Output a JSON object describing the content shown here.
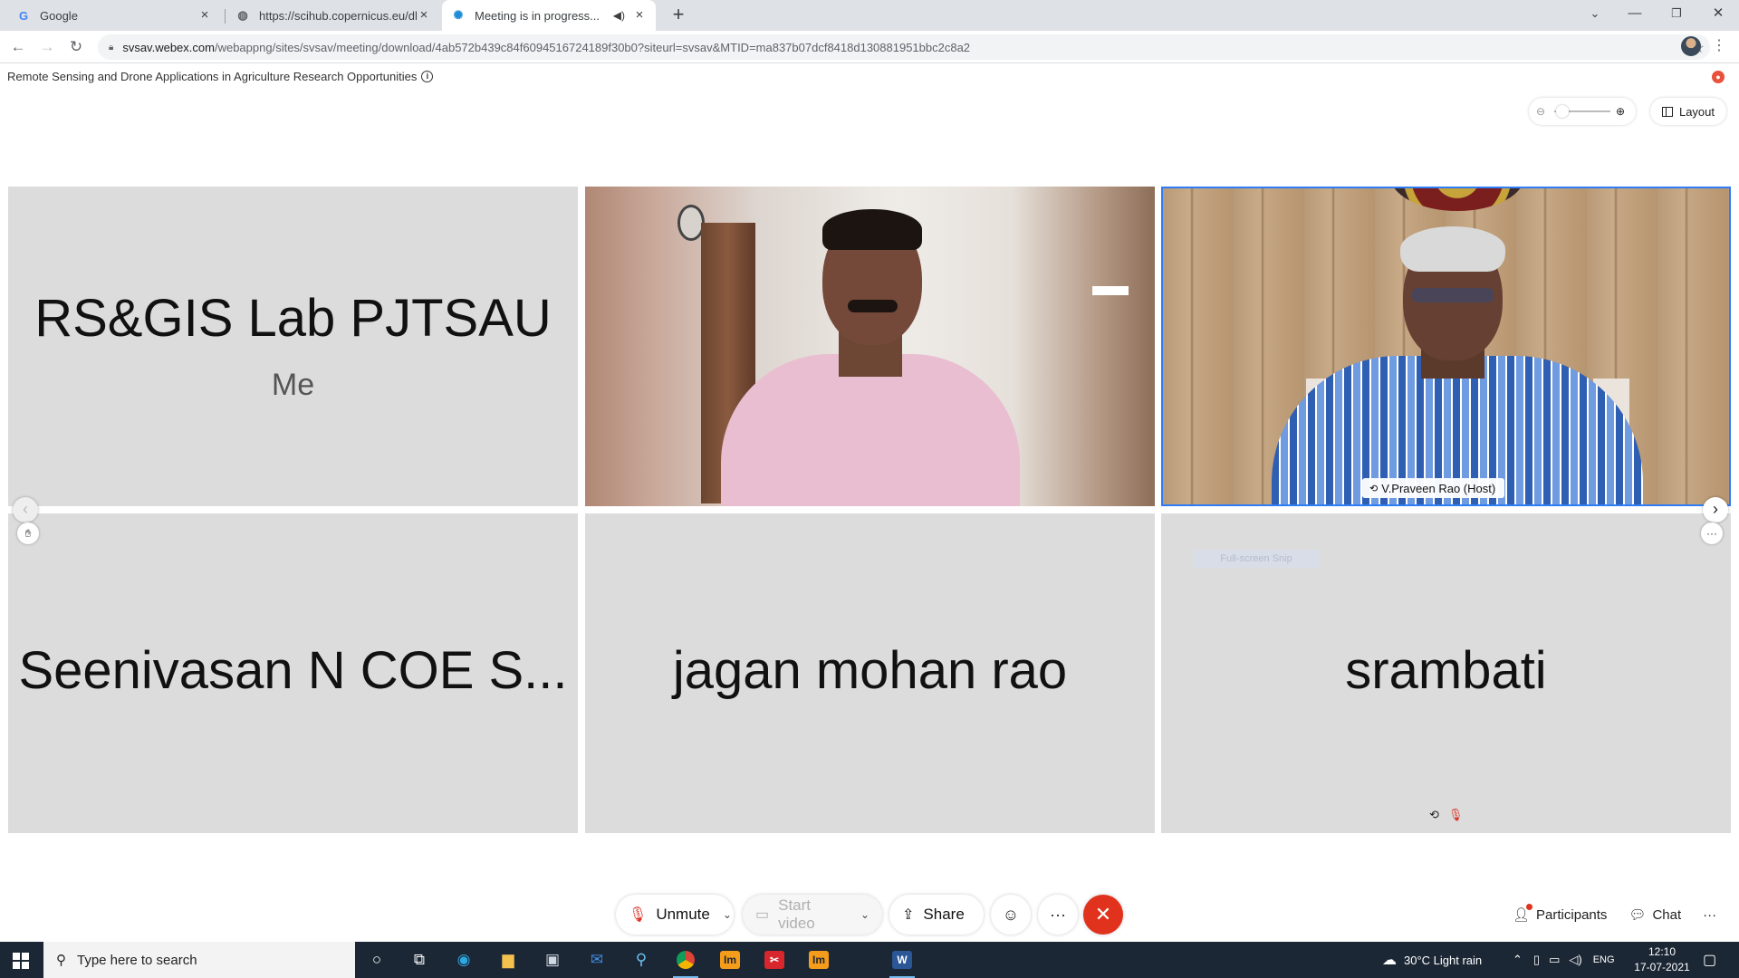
{
  "browser": {
    "tabs": [
      {
        "title": "Google",
        "favicon": "google-g-icon"
      },
      {
        "title": "https://scihub.copernicus.eu/dhu",
        "favicon": "globe-icon"
      },
      {
        "title": "Meeting is in progress...",
        "favicon": "webex-icon",
        "active": true
      }
    ],
    "url_host": "svsav.webex.com",
    "url_rest": "/webappng/sites/svsav/meeting/download/4ab572b439c84f6094516724189f30b0?siteurl=svsav&MTID=ma837b07dcf8418d130881951bbc2c8a2"
  },
  "meeting": {
    "title": "Remote Sensing and Drone Applications in Agriculture Research Opportunities",
    "layout_label": "Layout",
    "tiles": [
      {
        "name": "RS&GIS Lab PJTSAU",
        "sub": "Me"
      },
      {
        "name": "",
        "video": true
      },
      {
        "name": "",
        "video": true,
        "tag": "V.Praveen Rao (Host)"
      },
      {
        "name": "Seenivasan N COE S..."
      },
      {
        "name": "jagan mohan rao"
      },
      {
        "name": "srambati",
        "hint": "Full-screen Snip"
      }
    ],
    "controls": {
      "unmute": "Unmute",
      "start_video": "Start video",
      "share": "Share",
      "participants": "Participants",
      "chat": "Chat"
    }
  },
  "taskbar": {
    "search_placeholder": "Type here to search",
    "weather": "30°C  Light rain",
    "lang": "ENG",
    "time": "12:10",
    "date": "17-07-2021"
  }
}
